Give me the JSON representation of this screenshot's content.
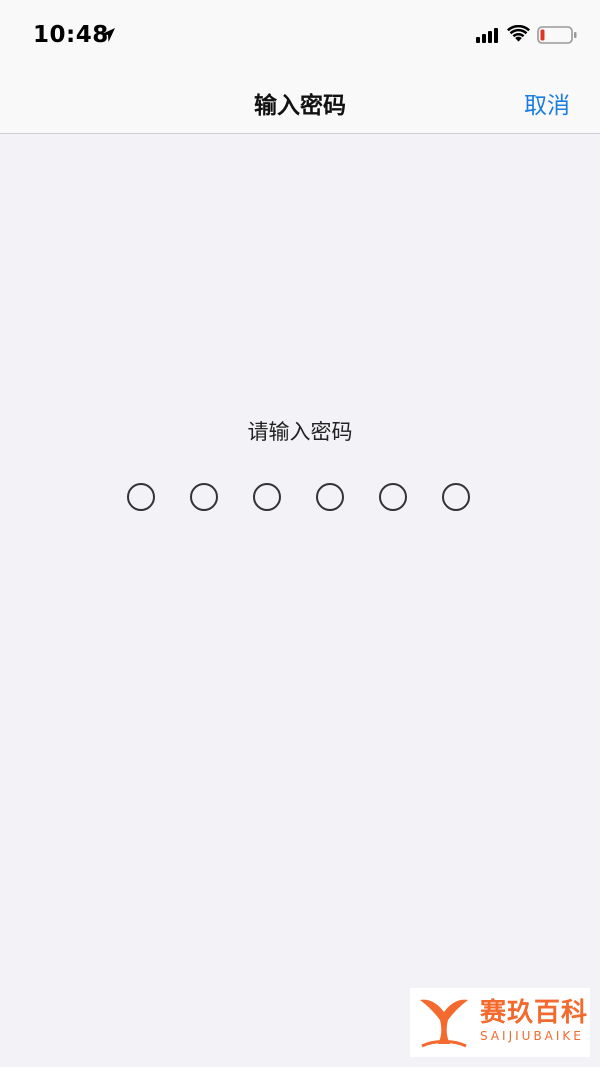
{
  "status_bar": {
    "time": "10:48",
    "icons": [
      "location-arrow-icon",
      "cellular-signal-icon",
      "wifi-icon",
      "battery-low-icon"
    ],
    "battery_color": "#e0352b"
  },
  "nav": {
    "title": "输入密码",
    "cancel_label": "取消",
    "accent_color": "#1a7de0"
  },
  "passcode": {
    "prompt": "请输入密码",
    "digits_total": 6,
    "digits_entered": 0
  },
  "watermark": {
    "text_cn": "赛玖百科",
    "text_en": "SAIJIUBAIKE",
    "brand_color": "#f26a2e"
  }
}
